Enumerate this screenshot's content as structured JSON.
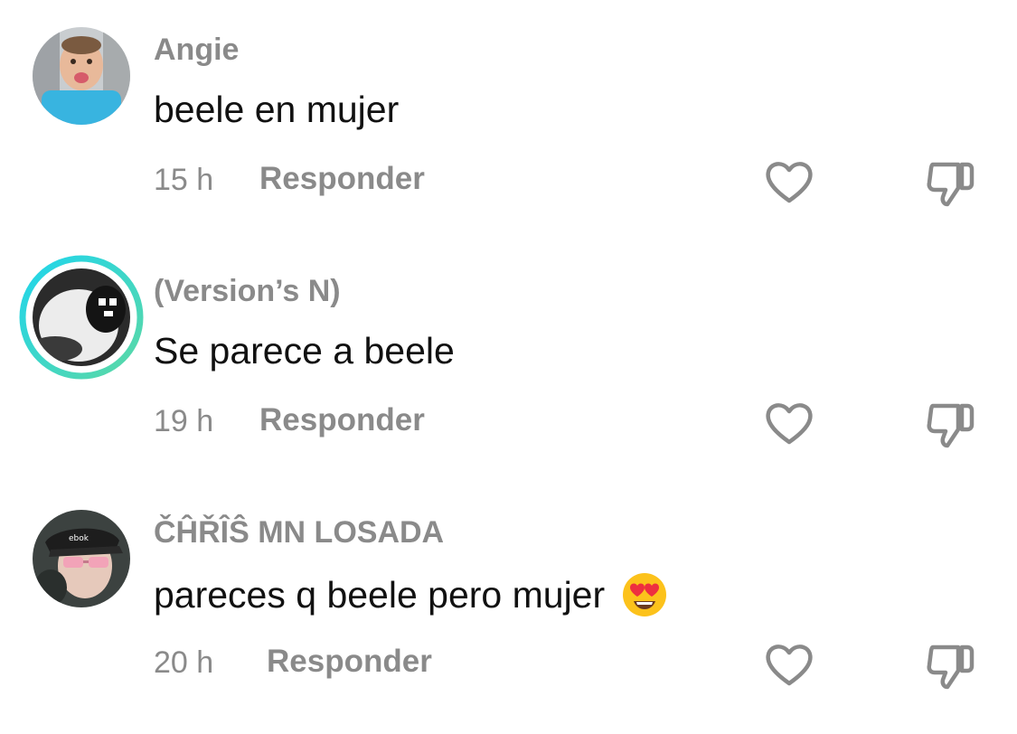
{
  "comments": [
    {
      "username": "Angie",
      "text": "beele en mujer",
      "time": "15 h",
      "reply_label": "Responder",
      "avatar_icon": "user-avatar-child",
      "has_story_ring": false,
      "emoji": null
    },
    {
      "username": "(Version’s N)",
      "text": "Se parece a beele",
      "time": "19 h",
      "reply_label": "Responder",
      "avatar_icon": "user-avatar-plush",
      "has_story_ring": true,
      "emoji": null
    },
    {
      "username": "ČĤŘÎŜ MN LOSADA",
      "text": "pareces q beele pero mujer",
      "time": "20 h",
      "reply_label": "Responder",
      "avatar_icon": "user-avatar-cap",
      "has_story_ring": false,
      "emoji": "heart-eyes-emoji"
    }
  ],
  "colors": {
    "muted_text": "#8a8a8a",
    "body_text": "#111111",
    "icon_stroke": "#8a8a8a",
    "story_ring_start": "#20d5ec",
    "story_ring_end": "#5bd8a5"
  }
}
